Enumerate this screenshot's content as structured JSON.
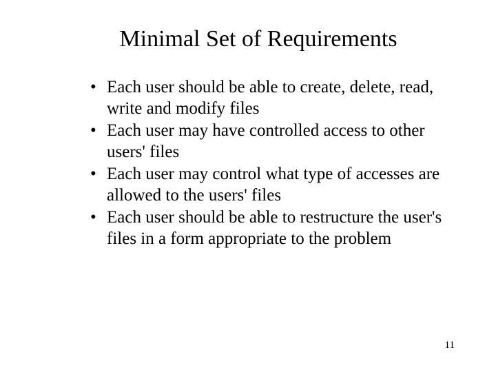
{
  "slide": {
    "title": "Minimal Set of Requirements",
    "bullets": [
      "Each user should be able to create, delete, read, write and modify files",
      "Each user may have controlled access to other users' files",
      "Each user may control what type of accesses are allowed to the users' files",
      "Each user should be able to restructure the user's files in a form appropriate to the problem"
    ],
    "page_number": "11"
  }
}
